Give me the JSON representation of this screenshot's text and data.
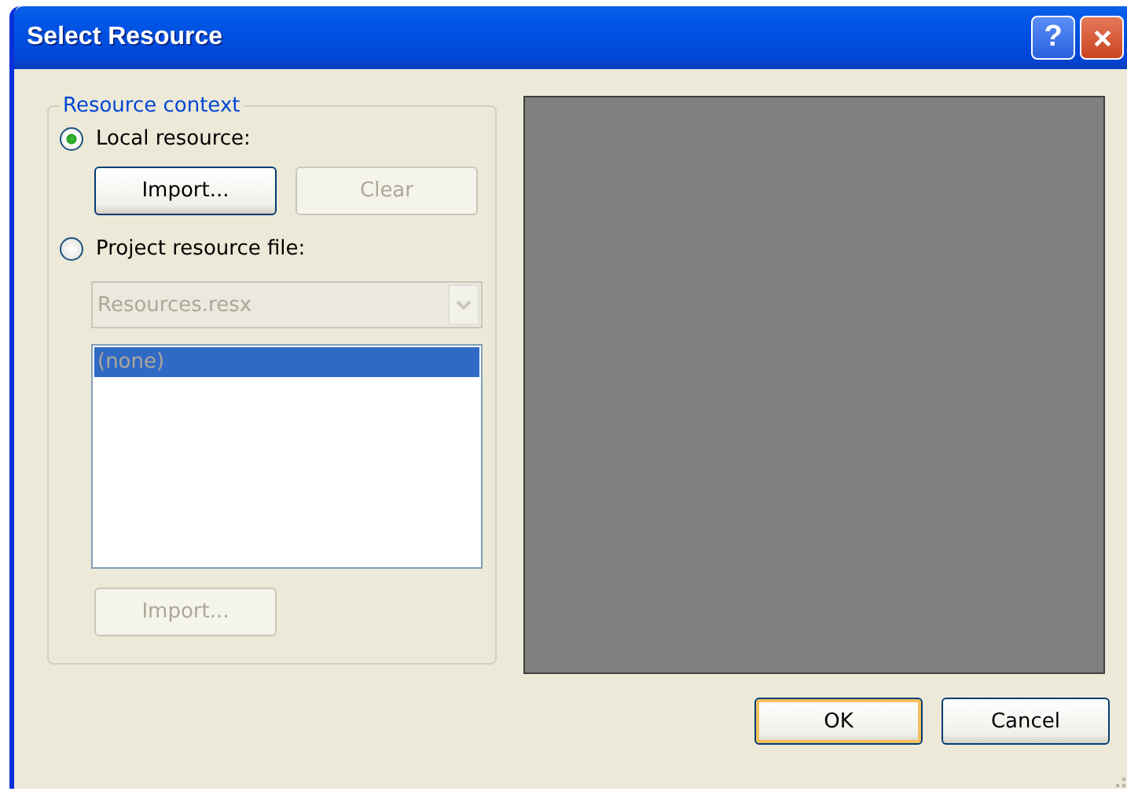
{
  "window": {
    "title": "Select Resource",
    "title_buttons": [
      {
        "kind": "help",
        "label": "?"
      },
      {
        "kind": "close"
      }
    ]
  },
  "resource_context": {
    "legend": "Resource context",
    "options": [
      {
        "label": "Local resource:",
        "selected": true
      },
      {
        "label": "Project resource file:",
        "selected": false
      }
    ],
    "local_buttons": [
      {
        "label": "Import...",
        "disabled": false
      },
      {
        "label": "Clear",
        "disabled": true
      }
    ],
    "resource_file": {
      "value": "Resources.resx",
      "disabled": true
    },
    "resource_list": {
      "disabled": true,
      "items": [
        {
          "label": "(none)",
          "selected": true
        }
      ]
    },
    "project_import": {
      "label": "Import...",
      "disabled": true
    }
  },
  "buttons": [
    {
      "label": "OK",
      "default": true
    },
    {
      "label": "Cancel",
      "default": false
    }
  ]
}
